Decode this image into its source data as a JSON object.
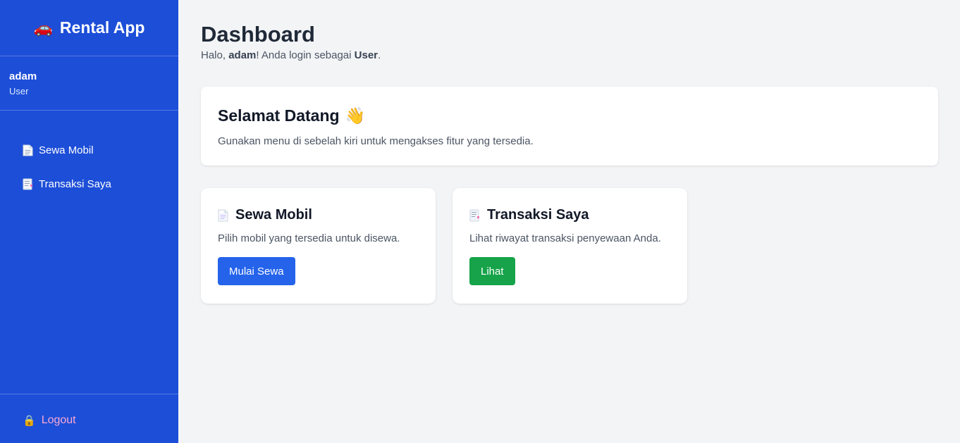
{
  "brand": {
    "icon": "car-icon",
    "name": "Rental App"
  },
  "user": {
    "name": "adam",
    "role": "User"
  },
  "sidebar": {
    "items": [
      {
        "label": "Sewa Mobil",
        "icon": "document-icon"
      },
      {
        "label": "Transaksi Saya",
        "icon": "receipt-icon"
      }
    ],
    "logout": {
      "label": "Logout",
      "icon": "lock-icon"
    }
  },
  "header": {
    "title": "Dashboard",
    "greeting_prefix": "Halo, ",
    "greeting_user": "adam",
    "greeting_middle": "! Anda login sebagai ",
    "greeting_role": "User",
    "greeting_suffix": "."
  },
  "welcome": {
    "title": "Selamat Datang",
    "emoji": "👋",
    "description": "Gunakan menu di sebelah kiri untuk mengakses fitur yang tersedia."
  },
  "cards": [
    {
      "title": "Sewa Mobil",
      "description": "Pilih mobil yang tersedia untuk disewa.",
      "button": "Mulai Sewa",
      "button_color": "#2563eb"
    },
    {
      "title": "Transaksi Saya",
      "description": "Lihat riwayat transaksi penyewaan Anda.",
      "button": "Lihat",
      "button_color": "#16a34a"
    }
  ],
  "colors": {
    "sidebar": "#1d4ed8",
    "background": "#f3f4f6",
    "logout": "#f9a8d4"
  }
}
